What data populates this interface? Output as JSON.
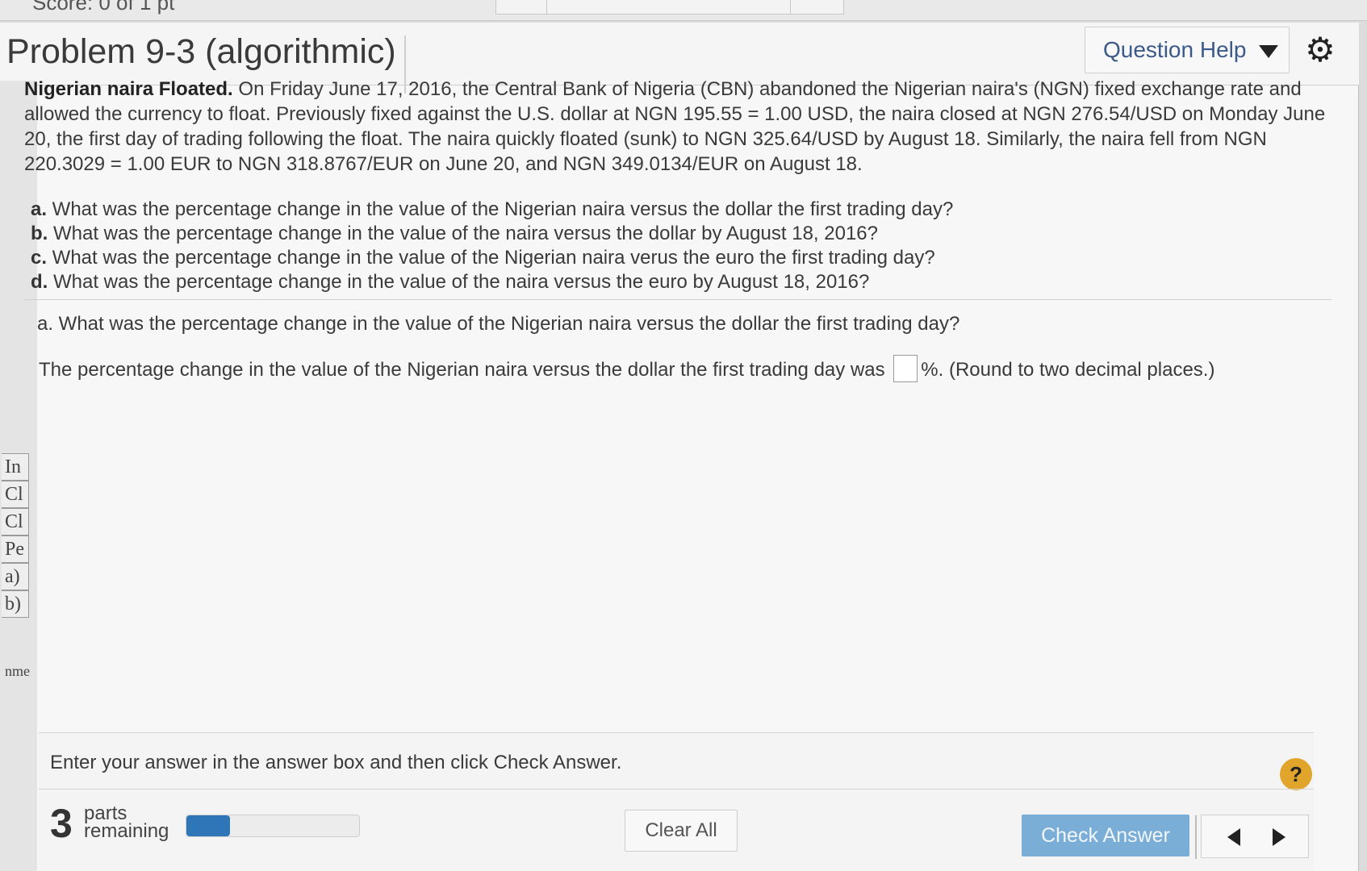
{
  "header": {
    "title": "Problem 9-3 (algorithmic)",
    "question_help": "Question Help",
    "score_fragment": "Score: 0 of 1 pt"
  },
  "left_fragments": [
    "In",
    "Cl",
    "Cl",
    "Pe",
    "a)",
    "b)",
    "nme"
  ],
  "problem": {
    "lead": "Nigerian naira Floated.",
    "text": " On Friday June 17, 2016, the Central Bank of Nigeria (CBN) abandoned the Nigerian naira's (NGN) fixed exchange rate and allowed the currency to float. Previously fixed against the U.S. dollar at NGN 195.55 = 1.00 USD, the naira closed at NGN 276.54/USD on Monday June 20, the first day of trading following the float. The naira quickly floated (sunk) to NGN 325.64/USD by August 18. Similarly, the naira fell from NGN 220.3029 = 1.00 EUR to NGN 318.8767/EUR on June 20, and NGN 349.0134/EUR on August 18."
  },
  "questions": [
    {
      "label": "a.",
      "text": " What was the percentage change in the value of the Nigerian naira versus the dollar the first trading day?"
    },
    {
      "label": "b.",
      "text": " What was the percentage change in the value of the naira versus the dollar by August 18, 2016?"
    },
    {
      "label": "c.",
      "text": " What was the percentage change in the value of the Nigerian naira verus the euro the first trading day?"
    },
    {
      "label": "d.",
      "text": " What was the percentage change in the value of the naira versus the euro by August 18, 2016?"
    }
  ],
  "current_part": {
    "label": "a.",
    "text": " What was the percentage change in the value of the Nigerian naira versus the dollar the first trading day?",
    "answer_prefix": "The percentage change in the value of the Nigerian naira versus the dollar the first trading day was",
    "answer_value": "",
    "answer_suffix": "%.  (Round to two decimal places.)"
  },
  "footer": {
    "instructions": "Enter your answer in the answer box and then click Check Answer.",
    "parts_count": "3",
    "parts_word1": "parts",
    "parts_word2": "remaining",
    "progress_fraction": 0.25,
    "clear_all": "Clear All",
    "check_answer": "Check Answer",
    "help_symbol": "?"
  },
  "colors": {
    "accent_blue": "#2e76b8",
    "check_button": "#7aaed6",
    "help_gold": "#e0a52a",
    "link_blue": "#3b5a8a"
  },
  "icons": {
    "settings": "gear-icon",
    "dropdown": "caret-down-icon",
    "previous": "triangle-left-icon",
    "next": "triangle-right-icon"
  }
}
